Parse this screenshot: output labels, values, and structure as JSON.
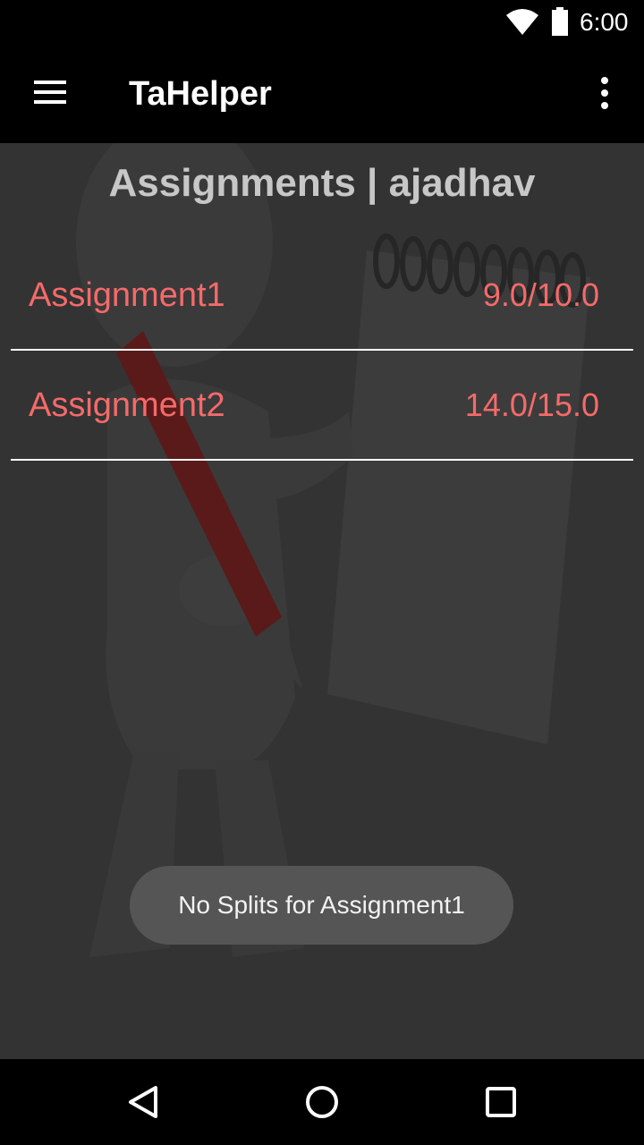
{
  "status_bar": {
    "time": "6:00",
    "icons": [
      "wifi-icon",
      "battery-icon"
    ]
  },
  "toolbar": {
    "title": "TaHelper",
    "icons": [
      "hamburger-menu-icon",
      "overflow-menu-icon"
    ]
  },
  "page": {
    "heading": "Assignments | ajadhav"
  },
  "assignments": [
    {
      "name": "Assignment1",
      "score": "9.0/10.0"
    },
    {
      "name": "Assignment2",
      "score": "14.0/15.0"
    }
  ],
  "toast": {
    "message": "No Splits for Assignment1"
  },
  "nav_bar": {
    "icons": [
      "back-icon",
      "home-icon",
      "recents-icon"
    ]
  },
  "colors": {
    "bars": "#000000",
    "background": "#333333",
    "heading": "#c7c7c7",
    "accent_text": "#f56a6a",
    "divider": "#ffffff",
    "toast_bg": "#555555"
  }
}
